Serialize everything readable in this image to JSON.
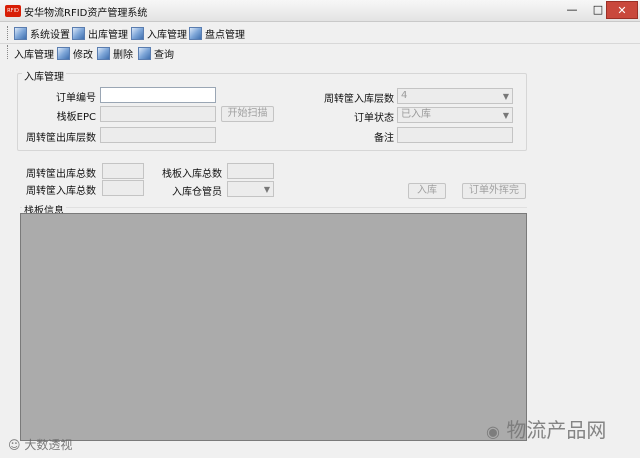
{
  "window": {
    "title": "安华物流RFID资产管理系统",
    "app_icon": "logo-icon",
    "buttons": {
      "minimize": "—",
      "maximize": "□",
      "close": "✕"
    }
  },
  "menu": [
    {
      "label": "系统设置",
      "icon": "menu-icon"
    },
    {
      "label": "出库管理",
      "icon": "menu-icon"
    },
    {
      "label": "入库管理",
      "icon": "menu-icon"
    },
    {
      "label": "盘点管理",
      "icon": "menu-icon"
    }
  ],
  "toolbar": {
    "section_label": "入库管理",
    "items": [
      {
        "label": "修改",
        "icon": "edit-icon"
      },
      {
        "label": "删除",
        "icon": "delete-icon"
      },
      {
        "label": "查询",
        "icon": "search-icon"
      }
    ]
  },
  "form": {
    "group_title": "入库管理",
    "order_no_label": "订单编号",
    "order_no_value": "",
    "pallet_epc_label": "栈板EPC",
    "pallet_epc_value": "",
    "start_scan_button": "开始扫描",
    "out_layers_label": "周转筐出库层数",
    "out_layers_value": "",
    "in_layers_label": "周转筐入库层数",
    "in_layers_value": "4",
    "order_status_label": "订单状态",
    "order_status_value": "已入库",
    "remark_label": "备注",
    "remark_value": ""
  },
  "summary": {
    "out_total_label": "周转筐出库总数",
    "out_total_value": "",
    "in_total_label": "周转筐入库总数",
    "in_total_value": "",
    "pallet_in_total_label": "栈板入库总数",
    "pallet_in_total_value": "",
    "warehouse_keeper_label": "入库仓管员",
    "warehouse_keeper_value": "",
    "stock_in_button": "入库",
    "order_check_button": "订单外挥完"
  },
  "pallet_info": {
    "title": "栈板信息"
  },
  "watermarks": {
    "left": "大数透视",
    "right": "物流产品网"
  }
}
